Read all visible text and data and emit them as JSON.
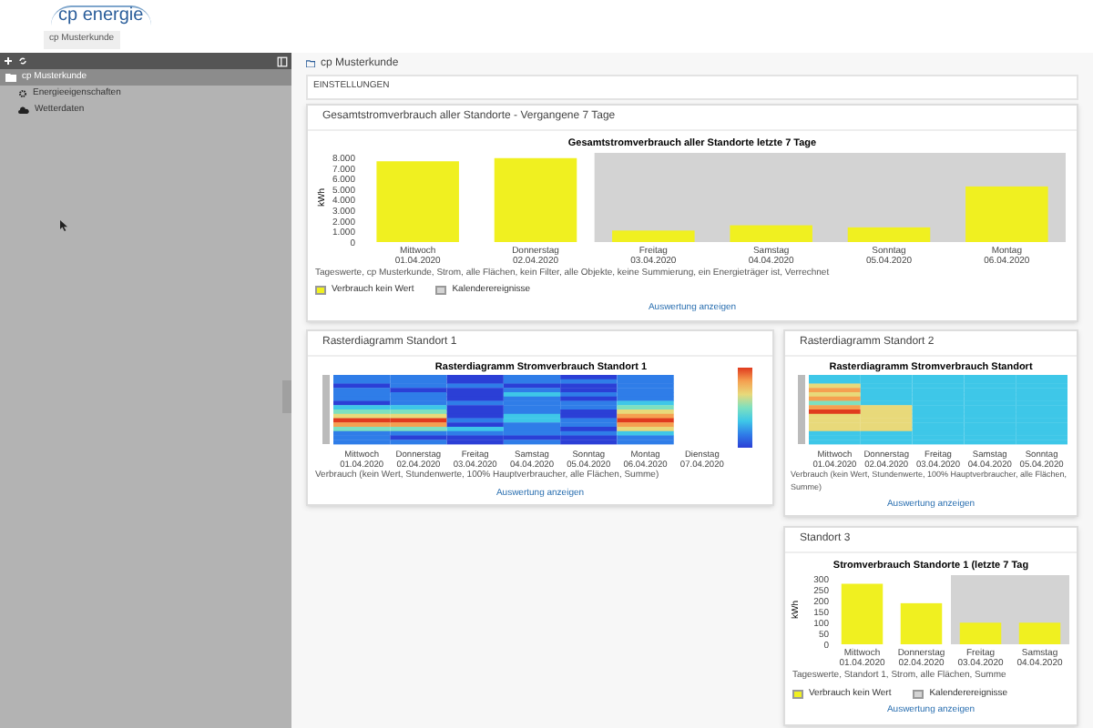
{
  "header": {
    "logo": "cp energie",
    "breadcrumb": "cp Musterkunde"
  },
  "sidebar": {
    "tree": [
      {
        "label": "cp Musterkunde",
        "selected": true,
        "children": [
          {
            "label": "Energieeigenschaften",
            "selected": false,
            "kind": "gear"
          },
          {
            "label": "Wetterdaten",
            "selected": false,
            "kind": "cloud"
          }
        ]
      }
    ]
  },
  "main": {
    "title": "cp Musterkunde",
    "settings": "EINSTELLUNGEN",
    "total_card": {
      "title": "Gesamtstromverbrauch aller Standorte - Vergangene 7 Tage",
      "chart_data": {
        "type": "bar",
        "title": "Gesamtstromverbrauch aller Standorte letzte 7 Tage",
        "ylabel": "kWh",
        "categories": [
          "Mittwoch 01.04.2020",
          "Donnerstag 02.04.2020",
          "Freitag 03.04.2020",
          "Samstag 04.04.2020",
          "Sonntag 05.04.2020",
          "Montag 06.04.2020"
        ],
        "series": [
          {
            "name": "Verbrauch kein Wert",
            "color": "#f0f020",
            "values": [
              7700,
              8000,
              1100,
              1600,
              1400,
              5300
            ]
          }
        ],
        "ylim": [
          0,
          8500
        ],
        "yticks": [
          {
            "value": 0,
            "label": "0"
          },
          {
            "value": 1000,
            "label": "1.000"
          },
          {
            "value": 2000,
            "label": "2.000"
          },
          {
            "value": 3000,
            "label": "3.000"
          },
          {
            "value": 4000,
            "label": "4.000"
          },
          {
            "value": 5000,
            "label": "5.000"
          },
          {
            "value": 6000,
            "label": "6.000"
          },
          {
            "value": 7000,
            "label": "7.000"
          },
          {
            "value": 8000,
            "label": "8.000"
          }
        ],
        "bands": [
          {
            "axis": "x",
            "from": "Freitag 03.04.2020",
            "to": "Montag 06.04.2020",
            "color": "#d3d3d3",
            "label": "Kalenderereignisse"
          }
        ]
      },
      "filter_note": "Tageswerte, cp Musterkunde, Strom, alle Flächen, kein Filter, alle Objekte, keine Summierung, ein Energieträger ist, Verrechnet",
      "link": "Auswertung anzeigen"
    },
    "raster_cards": [
      {
        "title": "Rasterdiagramm Standort 1",
        "chart_title": "Rasterdiagramm Stromverbrauch Standort 1",
        "days": [
          "Mittwoch 01.04.2020",
          "Donnerstag 02.04.2020",
          "Freitag 03.04.2020",
          "Samstag 04.04.2020",
          "Sonntag 05.04.2020",
          "Montag 06.04.2020",
          "Dienstag 07.04.2020"
        ],
        "note": "Verbrauch (kein Wert, Stundenwerte, 100% Hauptverbraucher, alle Flächen, Summe)",
        "link": "Auswertung anzeigen"
      },
      {
        "title": "Rasterdiagramm Standort 2",
        "chart_title": "Rasterdiagramm Stromverbrauch Standort",
        "days": [
          "Mittwoch 01.04.2020",
          "Donnerstag 02.04.2020",
          "Freitag 03.04.2020",
          "Samstag 04.04.2020",
          "Sonntag 05.04.2020"
        ],
        "note": "Verbrauch (kein Wert, Stundenwerte, 100% Hauptverbraucher, alle Flächen, Summe)",
        "link": "Auswertung anzeigen"
      }
    ],
    "standort_card": {
      "title": "Standort 3",
      "chart_data": {
        "type": "bar",
        "title": "Stromverbrauch Standorte 1 (letzte 7 Tag",
        "ylabel": "kWh",
        "categories": [
          "Mittwoch 01.04.2020",
          "Donnerstag 02.04.2020",
          "Freitag 03.04.2020",
          "Samstag 04.04.2020"
        ],
        "series": [
          {
            "name": "Verbrauch kein Wert",
            "color": "#f0f020",
            "values": [
              280,
              190,
              100,
              100
            ]
          }
        ],
        "ylim": [
          0,
          320
        ],
        "yticks": [
          0,
          50,
          100,
          150,
          200,
          250,
          300
        ],
        "bands": [
          {
            "axis": "x",
            "from": "Freitag 03.04.2020",
            "to": "Samstag 04.04.2020",
            "color": "#d3d3d3",
            "label": "Kalenderereignisse"
          }
        ]
      },
      "filter_note": "Tageswerte, Standort 1, Strom, alle Flächen, Summe",
      "link": "Auswertung anzeigen"
    }
  }
}
